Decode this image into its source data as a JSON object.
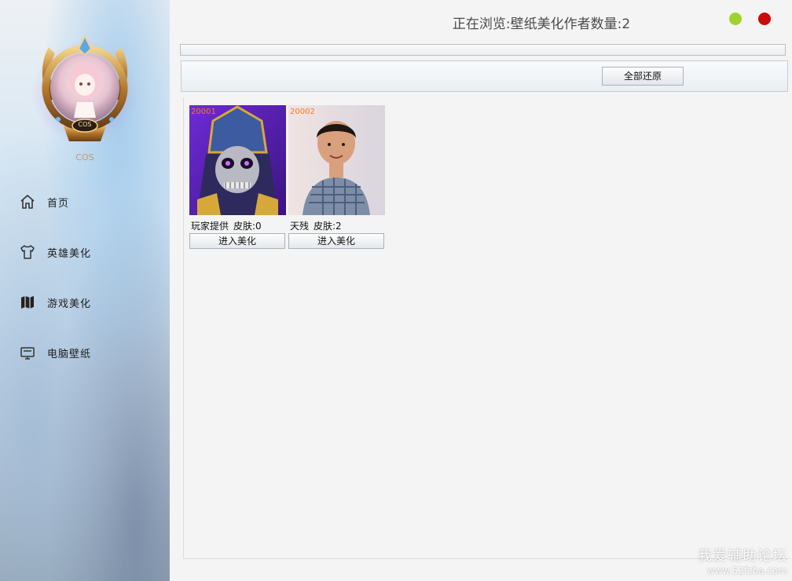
{
  "sidebar": {
    "avatar_badge": "COS",
    "user_name": "COS",
    "items": [
      {
        "label": "首页",
        "icon": "home-icon"
      },
      {
        "label": "英雄美化",
        "icon": "shirt-icon"
      },
      {
        "label": "游戏美化",
        "icon": "map-icon"
      },
      {
        "label": "电脑壁纸",
        "icon": "monitor-icon"
      }
    ]
  },
  "header": {
    "title": "正在浏览:壁纸美化作者数量:2",
    "minimize_color": "#9fd32b",
    "close_color": "#cc0a0a"
  },
  "toolbar": {
    "restore_all_label": "全部还原"
  },
  "cards": [
    {
      "id": "20001",
      "author": "玩家提供",
      "skins": "皮肤:0",
      "button": "进入美化",
      "image": "skeleton-knight-portrait"
    },
    {
      "id": "20002",
      "author": "天残",
      "skins": "皮肤:2",
      "button": "进入美化",
      "image": "boy-photo-portrait"
    }
  ],
  "watermark": {
    "line1": "我爱辅助论坛",
    "line2": "www.52fzba.com"
  }
}
